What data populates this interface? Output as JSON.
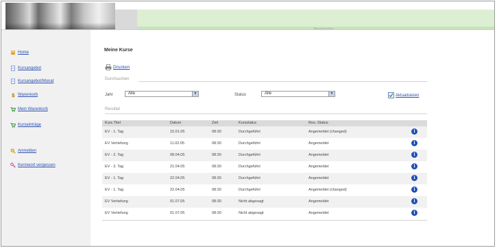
{
  "header": {
    "text": "Best practice"
  },
  "sidebar": {
    "items": [
      {
        "label": "Home"
      },
      {
        "label": "Kursangebot"
      },
      {
        "label": "Kursangebot/Monat"
      },
      {
        "label": "Warenkorb"
      },
      {
        "label": "Mein Warenkorb"
      },
      {
        "label": "Kurseinträge"
      },
      {
        "label": "Anmelden"
      },
      {
        "label": "Kennwort vergessen"
      }
    ]
  },
  "main": {
    "title": "Meine Kurse",
    "print_label": "Drucken",
    "durchsuchen_label": "Durchsuchen",
    "filters": {
      "jahr_label": "Jahr",
      "jahr_value": "Alle",
      "status_label": "Status",
      "status_value": "Alle",
      "refresh_label": "Aktualisieren"
    },
    "resultat_label": "Resultat",
    "table": {
      "columns": [
        "Kurs Titel",
        "Datum",
        "Zeit",
        "Kursstatus",
        "Res.-Status"
      ],
      "rows": [
        [
          "EV - 1. Tag",
          "15.01.05",
          "08:30",
          "Durchgeführt",
          "Angemeldet (changed)"
        ],
        [
          "EV Vertiefung",
          "11.02.05",
          "08:30",
          "Durchgeführt",
          "Angemeldet"
        ],
        [
          "EV - 2. Tag",
          "08.04.05",
          "08:30",
          "Durchgeführt",
          "Angemeldet"
        ],
        [
          "EV - 3. Tag",
          "21.04.05",
          "08:30",
          "Durchgeführt",
          "Angemeldet"
        ],
        [
          "EV - 1. Tag",
          "22.04.05",
          "08:30",
          "Durchgeführt",
          "Angemeldet"
        ],
        [
          "EV - 1. Tag",
          "22.04.05",
          "08:30",
          "Durchgeführt",
          "Angemeldet (changed)"
        ],
        [
          "EV Vertiefung",
          "01.07.05",
          "08:30",
          "Nicht abgesagt",
          "Angemeldet"
        ],
        [
          "EV Vertiefung",
          "01.07.05",
          "08:30",
          "Nicht abgesagt",
          "Angemeldet"
        ]
      ]
    }
  },
  "colors": {
    "link": "#2a4fb0",
    "header_green": "#dcefd3",
    "info_icon": "#1f4fb4"
  },
  "icons": [
    "home-icon",
    "document-icon",
    "document-icon",
    "dollar-icon",
    "cart-icon",
    "cart-icon",
    "search-icon",
    "key-icon",
    "printer-icon",
    "checkbox-icon",
    "info-icon"
  ]
}
